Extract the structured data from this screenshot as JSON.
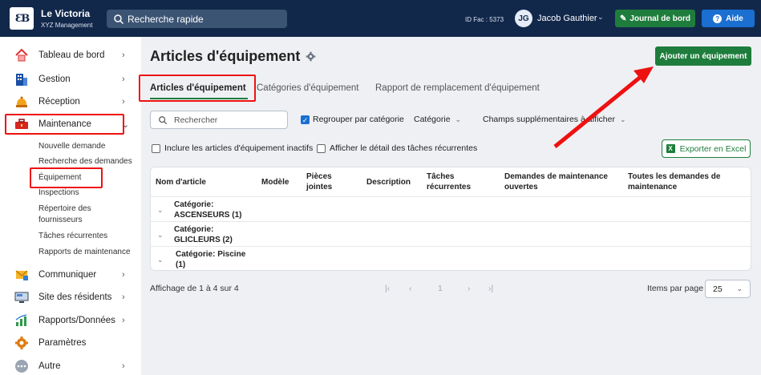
{
  "header": {
    "logo_text": "ƐB",
    "app_name": "Le Victoria",
    "app_subtitle": "XYZ Management",
    "search_placeholder": "Recherche rapide",
    "facility_id": "ID Fac : 5373",
    "user_initials": "JG",
    "user_name": "Jacob Gauthier",
    "journal_label": "Journal de bord",
    "help_label": "Aide"
  },
  "sidebar": {
    "items": [
      {
        "label": "Tableau de bord",
        "icon": "house-icon"
      },
      {
        "label": "Gestion",
        "icon": "building-icon"
      },
      {
        "label": "Réception",
        "icon": "bell-icon"
      },
      {
        "label": "Maintenance",
        "icon": "toolbox-icon"
      },
      {
        "label": "Communiquer",
        "icon": "envelope-icon"
      },
      {
        "label": "Site des résidents",
        "icon": "monitor-icon"
      },
      {
        "label": "Rapports/Données",
        "icon": "bar-chart-icon"
      },
      {
        "label": "Paramètres",
        "icon": "gear-icon"
      },
      {
        "label": "Autre",
        "icon": "more-icon"
      }
    ],
    "maintenance_sub": [
      "Nouvelle demande",
      "Recherche des demandes",
      "Équipement",
      "Inspections",
      "Répertoire des",
      "fournisseurs",
      "Tâches récurrentes",
      "Rapports de maintenance"
    ]
  },
  "main": {
    "title": "Articles d'équipement",
    "add_button": "Ajouter un équipement",
    "tabs": [
      "Articles d'équipement",
      "Catégories d'équipement",
      "Rapport de remplacement d'équipement"
    ],
    "search_placeholder": "Rechercher",
    "group_by_category": "Regrouper par catégorie",
    "category_filter": "Catégorie",
    "extra_fields": "Champs supplémentaires à afficher",
    "include_inactive": "Inclure les articles d'équipement inactifs",
    "show_recurring_detail": "Afficher le détail des tâches récurrentes",
    "export_label": "Exporter en Excel",
    "columns": [
      "Nom d'article",
      "Modèle",
      "Pièces jointes",
      "Description",
      "Tâches récurrentes",
      "Demandes de maintenance ouvertes",
      "Toutes les demandes de maintenance"
    ],
    "rows": [
      {
        "line1": "Catégorie:",
        "line2": "ASCENSEURS (1)"
      },
      {
        "line1": "Catégorie:",
        "line2": "GLICLEURS (2)"
      },
      {
        "line1": "Catégorie: Piscine",
        "line2": "(1)"
      }
    ],
    "footer": {
      "showing": "Affichage de 1 à 4 sur 4",
      "page": "1",
      "items_per_page_label": "Items par page",
      "items_per_page_value": "25"
    }
  },
  "colors": {
    "topbar": "#12284b",
    "green": "#1e7d3c",
    "blue": "#1a6fd1",
    "annotation": "#e11111"
  }
}
